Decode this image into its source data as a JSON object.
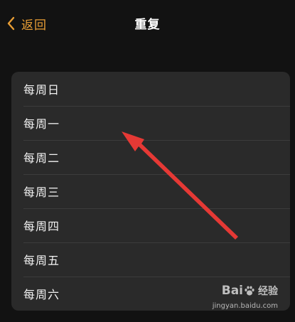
{
  "nav": {
    "back_label": "返回",
    "title": "重复",
    "back_icon": "chevron-left-icon",
    "accent_color": "#e99e35"
  },
  "repeat_options": [
    {
      "label": "每周日"
    },
    {
      "label": "每周一"
    },
    {
      "label": "每周二"
    },
    {
      "label": "每周三"
    },
    {
      "label": "每周四"
    },
    {
      "label": "每周五"
    },
    {
      "label": "每周六"
    }
  ],
  "annotation": {
    "icon": "red-arrow-annotation",
    "color": "#e53935"
  },
  "watermark": {
    "brand_left": "Bai",
    "brand_right": "经验",
    "url": "jingyan.baidu.com",
    "icon": "baidu-paw-icon"
  }
}
